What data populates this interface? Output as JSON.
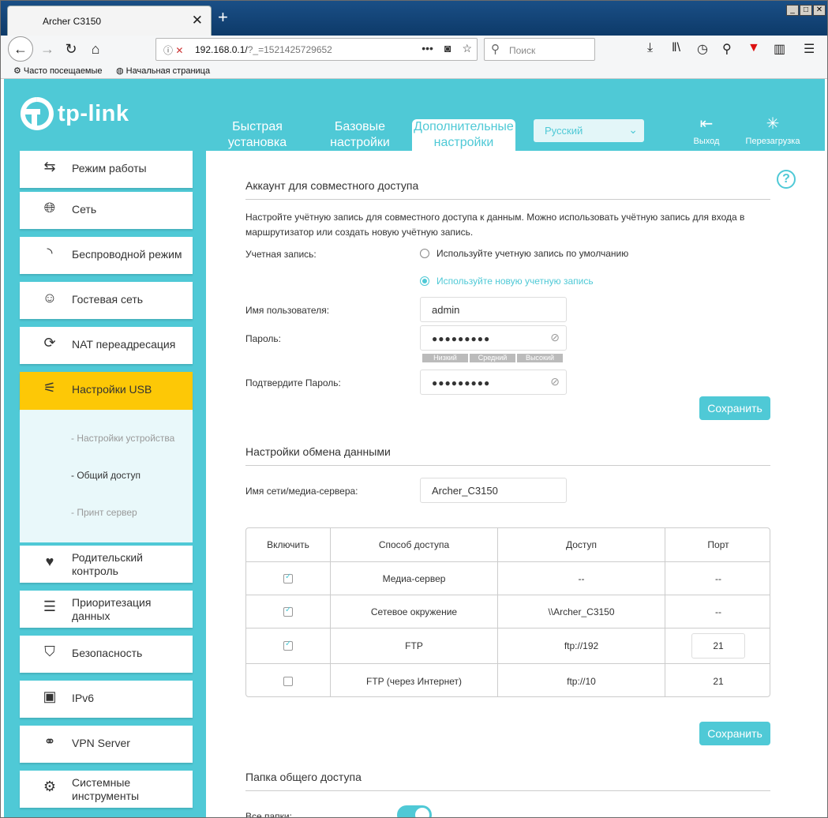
{
  "browser": {
    "tab_title": "Archer C3150",
    "url_host": "192.168.0.1/",
    "url_path": "?_=1521425729652",
    "search_placeholder": "Поиск",
    "bookmarks": [
      "Часто посещаемые",
      "Начальная страница"
    ]
  },
  "header": {
    "logo": "tp-link",
    "nav": [
      {
        "line1": "Быстрая",
        "line2": "установка"
      },
      {
        "line1": "Базовые",
        "line2": "настройки"
      },
      {
        "line1": "Дополнительные",
        "line2": "настройки"
      }
    ],
    "language": "Русский",
    "logout": "Выход",
    "reboot": "Перезагрузка"
  },
  "sidebar": {
    "items": [
      {
        "label": "Режим работы",
        "icon": "switch-arrows-icon"
      },
      {
        "label": "Сеть",
        "icon": "globe-icon"
      },
      {
        "label": "Беспроводной режим",
        "icon": "wifi-icon"
      },
      {
        "label": "Гостевая сеть",
        "icon": "users-icon"
      },
      {
        "label": "NAT переадресация",
        "icon": "nat-icon"
      },
      {
        "label": "Настройки USB",
        "icon": "usb-icon"
      },
      {
        "line1": "Родительский",
        "line2": "контроль",
        "icon": "family-icon"
      },
      {
        "line1": "Приоритезация",
        "line2": "данных",
        "icon": "qos-icon"
      },
      {
        "label": "Безопасность",
        "icon": "shield-icon"
      },
      {
        "label": "IPv6",
        "icon": "ipv6-icon"
      },
      {
        "label": "VPN Server",
        "icon": "link-icon"
      },
      {
        "line1": "Системные",
        "line2": "инструменты",
        "icon": "gear-icon"
      }
    ],
    "usb_sub": [
      "- Настройки устройства",
      "- Общий доступ",
      "- Принт сервер"
    ]
  },
  "main": {
    "account_section": {
      "title": "Аккаунт для совместного доступа",
      "description": "Настройте учётную запись для совместного доступа к данным. Можно использовать учётную запись для входа в маршрутизатор или создать новую учётную запись.",
      "account_label": "Учетная запись:",
      "radio_default": "Используйте учетную запись по умолчанию",
      "radio_new": "Используйте новую учетную запись",
      "username_label": "Имя пользователя:",
      "username_value": "admin",
      "password_label": "Пароль:",
      "password_mask": "●●●●●●●●●",
      "strength": [
        "Низкий",
        "Средний",
        "Высокий"
      ],
      "confirm_label": "Подтвердите Пароль:",
      "confirm_mask": "●●●●●●●●●",
      "save": "Сохранить"
    },
    "exchange_section": {
      "title": "Настройки обмена данными",
      "server_label": "Имя сети/медиа-сервера:",
      "server_value": "Archer_C3150",
      "table": {
        "headers": [
          "Включить",
          "Способ доступа",
          "Доступ",
          "Порт"
        ],
        "rows": [
          {
            "checked": true,
            "method": "Медиа-сервер",
            "access": "--",
            "port": "--"
          },
          {
            "checked": true,
            "method": "Сетевое окружение",
            "access": "\\\\Archer_C3150",
            "port": "--"
          },
          {
            "checked": true,
            "method": "FTP",
            "access": "ftp://192",
            "port": "21"
          },
          {
            "checked": false,
            "method": "FTP (через Интернет)",
            "access": "ftp://10",
            "port": "21"
          }
        ]
      },
      "save": "Сохранить"
    },
    "folder_section": {
      "title": "Папка общего доступа",
      "all_folders_label": "Все папки:"
    }
  }
}
